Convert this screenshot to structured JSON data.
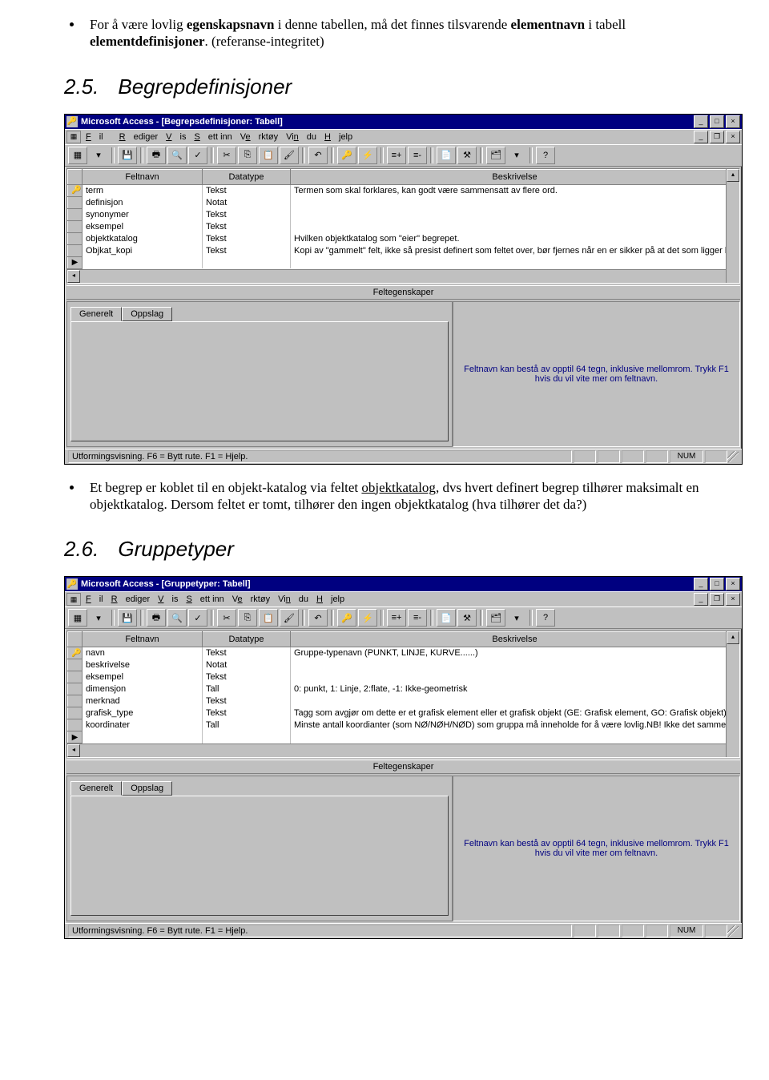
{
  "doc": {
    "bullet1_pre": "For å være lovlig ",
    "bullet1_b1": "egenskapsnavn",
    "bullet1_mid1": " i denne tabellen, må det finnes tilsvarende ",
    "bullet1_b2": "elementnavn",
    "bullet1_mid2": " i tabell ",
    "bullet1_b3": "elementdefinisjoner",
    "bullet1_post": ". (referanse-integritet)",
    "sec25_num": "2.5.",
    "sec25_title": "Begrepdefinisjoner",
    "bullet2_pre": "Et begrep er koblet til en objekt-katalog via feltet ",
    "bullet2_u": "objektkatalog",
    "bullet2_post": ", dvs hvert definert begrep tilhører maksimalt en objektkatalog. Dersom feltet er tomt, tilhører den ingen objektkatalog (hva tilhører det da?)",
    "sec26_num": "2.6.",
    "sec26_title": "Gruppetyper"
  },
  "win1": {
    "title": "Microsoft Access - [Begrepsdefinisjoner: Tabell]",
    "menu": [
      "Fil",
      "Rediger",
      "Vis",
      "Sett inn",
      "Verktøy",
      "Vindu",
      "Hjelp"
    ],
    "headers": [
      "Feltnavn",
      "Datatype",
      "Beskrivelse"
    ],
    "rows": [
      {
        "key": "🔑",
        "name": "term",
        "type": "Tekst",
        "desc": "Termen som skal forklares, kan godt være sammensatt av flere ord."
      },
      {
        "key": "",
        "name": "definisjon",
        "type": "Notat",
        "desc": ""
      },
      {
        "key": "",
        "name": "synonymer",
        "type": "Tekst",
        "desc": ""
      },
      {
        "key": "",
        "name": "eksempel",
        "type": "Tekst",
        "desc": ""
      },
      {
        "key": "",
        "name": "objektkatalog",
        "type": "Tekst",
        "desc": "Hvilken objektkatalog som \"eier\" begrepet."
      },
      {
        "key": "",
        "name": "Objkat_kopi",
        "type": "Tekst",
        "desc": "Kopi av \"gammelt\" felt, ikke så presist definert som feltet over, bør fjernes når en er sikker på at det som ligger h"
      },
      {
        "key": "▶",
        "name": "",
        "type": "",
        "desc": ""
      }
    ],
    "felt_label": "Feltegenskaper",
    "tab1": "Generelt",
    "tab2": "Oppslag",
    "hint": "Feltnavn kan bestå av opptil 64 tegn, inklusive mellomrom. Trykk F1 hvis du vil vite mer om feltnavn.",
    "status": "Utformingsvisning. F6 = Bytt rute. F1 = Hjelp.",
    "status_num": "NUM"
  },
  "win2": {
    "title": "Microsoft Access - [Gruppetyper: Tabell]",
    "menu": [
      "Fil",
      "Rediger",
      "Vis",
      "Sett inn",
      "Verktøy",
      "Vindu",
      "Hjelp"
    ],
    "headers": [
      "Feltnavn",
      "Datatype",
      "Beskrivelse"
    ],
    "rows": [
      {
        "key": "🔑",
        "name": "navn",
        "type": "Tekst",
        "desc": "Gruppe-typenavn (PUNKT, LINJE, KURVE......)"
      },
      {
        "key": "",
        "name": "beskrivelse",
        "type": "Notat",
        "desc": ""
      },
      {
        "key": "",
        "name": "eksempel",
        "type": "Tekst",
        "desc": ""
      },
      {
        "key": "",
        "name": "dimensjon",
        "type": "Tall",
        "desc": "0: punkt, 1: Linje, 2:flate, -1: Ikke-geometrisk"
      },
      {
        "key": "",
        "name": "merknad",
        "type": "Tekst",
        "desc": ""
      },
      {
        "key": "",
        "name": "grafisk_type",
        "type": "Tekst",
        "desc": "Tagg som avgjør om dette er et grafisk element eller et grafisk objekt (GE: Grafisk element, GO: Grafisk objekt)"
      },
      {
        "key": "",
        "name": "koordinater",
        "type": "Tall",
        "desc": "Minste antall koordianter (som NØ/NØH/NØD) som gruppa må inneholde for å være lovlig.NB! Ikke det samme so"
      },
      {
        "key": "▶",
        "name": "",
        "type": "",
        "desc": ""
      }
    ],
    "felt_label": "Feltegenskaper",
    "tab1": "Generelt",
    "tab2": "Oppslag",
    "hint": "Feltnavn kan bestå av opptil 64 tegn, inklusive mellomrom. Trykk F1 hvis du vil vite mer om feltnavn.",
    "status": "Utformingsvisning. F6 = Bytt rute. F1 = Hjelp.",
    "status_num": "NUM"
  }
}
